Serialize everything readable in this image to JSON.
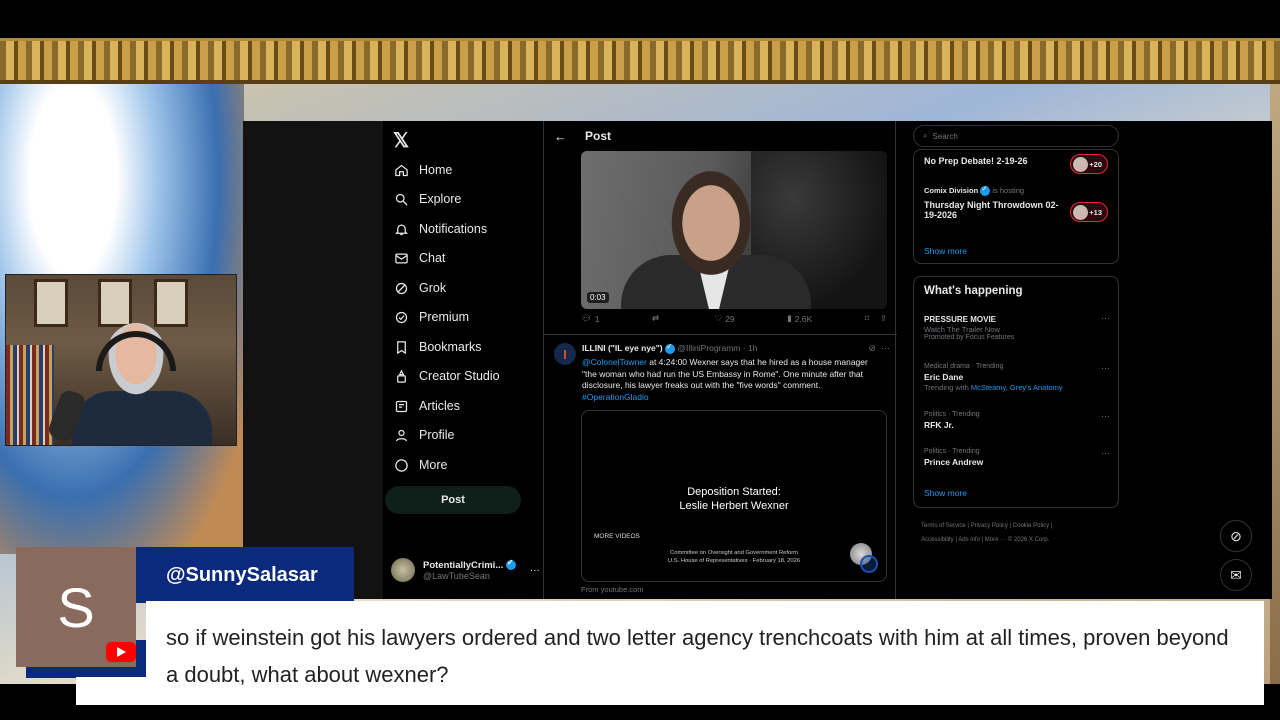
{
  "x_nav": {
    "logo": "𝕏",
    "items": [
      {
        "label": "Home"
      },
      {
        "label": "Explore"
      },
      {
        "label": "Notifications"
      },
      {
        "label": "Chat"
      },
      {
        "label": "Grok"
      },
      {
        "label": "Premium"
      },
      {
        "label": "Bookmarks"
      },
      {
        "label": "Creator Studio"
      },
      {
        "label": "Articles"
      },
      {
        "label": "Profile"
      },
      {
        "label": "More"
      }
    ],
    "post_button": "Post",
    "account": {
      "name": "PotentiallyCrimi...",
      "handle": "@LawTubeSean",
      "more": "···"
    }
  },
  "main": {
    "header": {
      "back": "←",
      "title": "Post"
    },
    "video1": {
      "duration": "0:03"
    },
    "actions": {
      "replies": "1",
      "reposts": "",
      "likes": "29",
      "views": "2.6K"
    },
    "tweet2": {
      "name": "ILLINI (\"IL eye nye\")",
      "handle": "@IlliniProgramm",
      "time": "· 1h",
      "avatar_letter": "I",
      "mention": "@ColonelTowner",
      "text": " at 4:24:00 Wexner says that he hired as a house manager \"the woman who had run the US Embassy in Rome\".  One minute after that disclosure, his lawyer freaks out with the \"five words\" comment.",
      "hashtag": "#OperationGladio"
    },
    "video2": {
      "title_line1": "Deposition Started:",
      "title_line2": "Leslie Herbert Wexner",
      "more_videos": "MORE VIDEOS",
      "committee_line1": "Committee on Oversight and Government Reform",
      "committee_line2": "U.S. House of Representatives · February 18, 2026"
    },
    "from": "From youtube.com"
  },
  "right": {
    "search_placeholder": "Search",
    "spaces": [
      {
        "title": "No Prep Debate! 2-19-26",
        "count": "+20"
      },
      {
        "host": "Comix Division",
        "host_suffix": "is hosting",
        "title": "Thursday Night Throwdown 02-19-2026",
        "count": "+13"
      }
    ],
    "spaces_show_more": "Show more",
    "happening_title": "What's happening",
    "trends": [
      {
        "ctx": "",
        "name": "PRESSURE MOVIE",
        "sub": "Watch The Trailer Now",
        "sub2": "Promoted by Focus Features"
      },
      {
        "ctx": "Medical drama · Trending",
        "name": "Eric Dane",
        "sub": "Trending with",
        "sub_links": "McSteamy, Grey's Anatomy"
      },
      {
        "ctx": "Politics · Trending",
        "name": "RFK Jr."
      },
      {
        "ctx": "Politics · Trending",
        "name": "Prince Andrew"
      }
    ],
    "happening_show_more": "Show more",
    "footer_line1": "Terms of Service  |  Privacy Policy  |  Cookie Policy  |",
    "footer_line2": "Accessibility  |  Ads info  |  More ···  © 2026 X Corp."
  },
  "chat": {
    "avatar_letter": "S",
    "username": "@SunnySalasar",
    "message": "so if weinstein got his lawyers ordered and two letter agency trenchcoats with him at all times, proven beyond a doubt, what about wexner?"
  }
}
